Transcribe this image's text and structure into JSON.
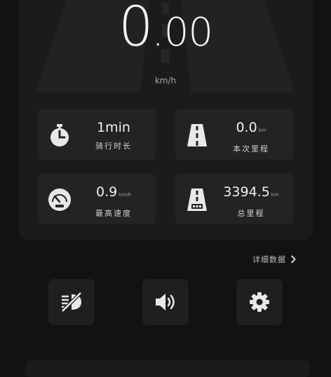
{
  "speedometer": {
    "speed_int": "0",
    "speed_dot": ".",
    "speed_dec": "00",
    "unit": "km/h"
  },
  "stats": {
    "ride_time": {
      "value": "1min",
      "unit": "",
      "label": "骑行时长",
      "icon": "stopwatch-icon"
    },
    "trip_distance": {
      "value": "0.0",
      "unit": "km",
      "label": "本次里程",
      "icon": "road-icon"
    },
    "max_speed": {
      "value": "0.9",
      "unit": "km/h",
      "label": "最高速度",
      "icon": "gauge-icon"
    },
    "total_distance": {
      "value": "3394.5",
      "unit": "km",
      "label": "总里程",
      "icon": "odometer-road-icon"
    }
  },
  "detail_link": {
    "label": "详细数据",
    "icon": "chevron-right-icon"
  },
  "toolbar": {
    "buttons": [
      {
        "name": "headlight-off-button",
        "icon": "headlight-off-icon"
      },
      {
        "name": "sound-button",
        "icon": "speaker-icon"
      },
      {
        "name": "settings-button",
        "icon": "gear-icon"
      }
    ]
  },
  "colors": {
    "background": "#121212",
    "panel": "#1b1b1b",
    "card": "#232323",
    "text": "#f0f0f0",
    "muted": "#a9a9a9"
  }
}
